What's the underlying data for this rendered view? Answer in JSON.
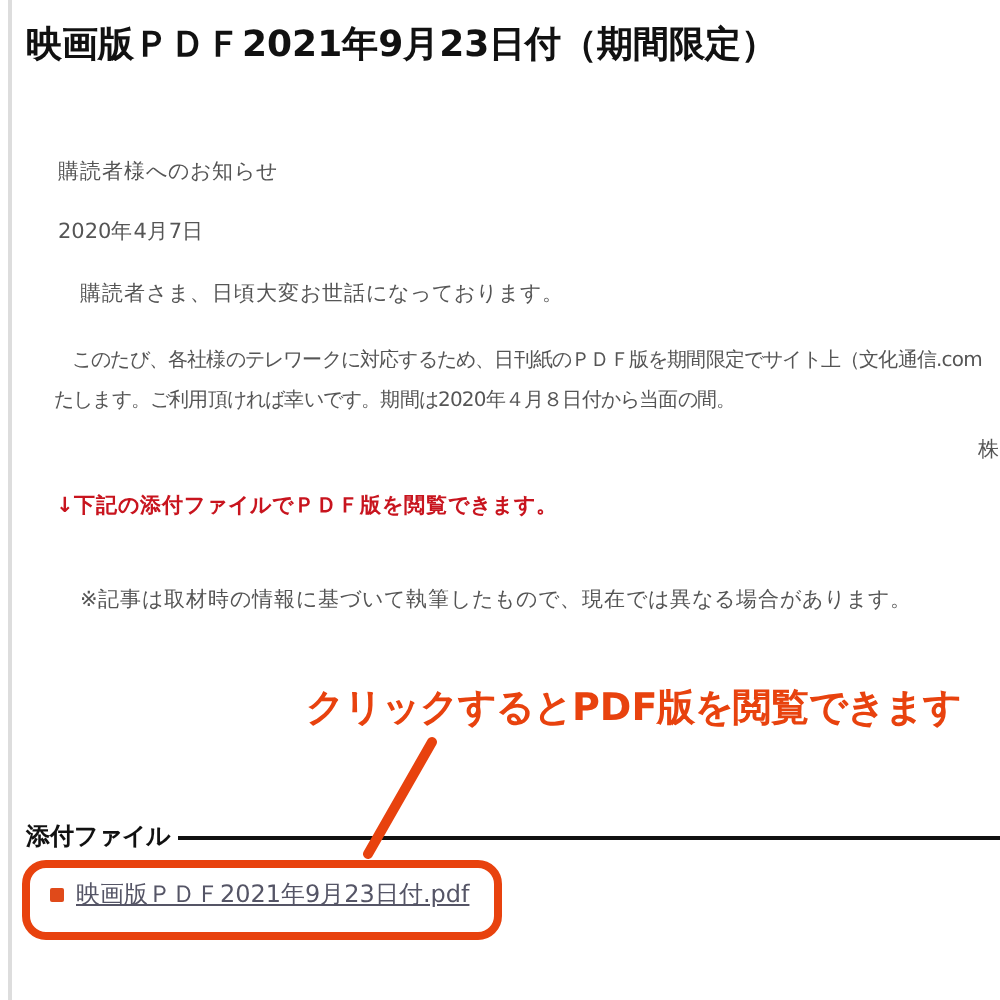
{
  "title": "映画版ＰＤＦ2021年9月23日付（期間限定）",
  "body": {
    "heading": "購読者様へのお知らせ",
    "date": "2020年4月7日",
    "greeting": "購読者さま、日頃大変お世話になっております。",
    "paragraph": [
      "このたび、各社様のテレワークに対応するため、日刊紙のＰＤＦ版を期間限定でサイト上（文化通信.com",
      "たします。ご利用頂ければ幸いです。期間は2020年４月８日付から当面の間。"
    ],
    "signature": "株",
    "notice": "↓下記の添付ファイルでＰＤＦ版を閲覧できます。",
    "note": "※記事は取材時の情報に基づいて執筆したもので、現在では異なる場合があります。"
  },
  "attachments": {
    "label": "添付ファイル",
    "files": [
      "映画版ＰＤＦ2021年9月23日付.pdf"
    ]
  },
  "annotation": {
    "text": "クリックするとPDF版を閲覧できます"
  }
}
